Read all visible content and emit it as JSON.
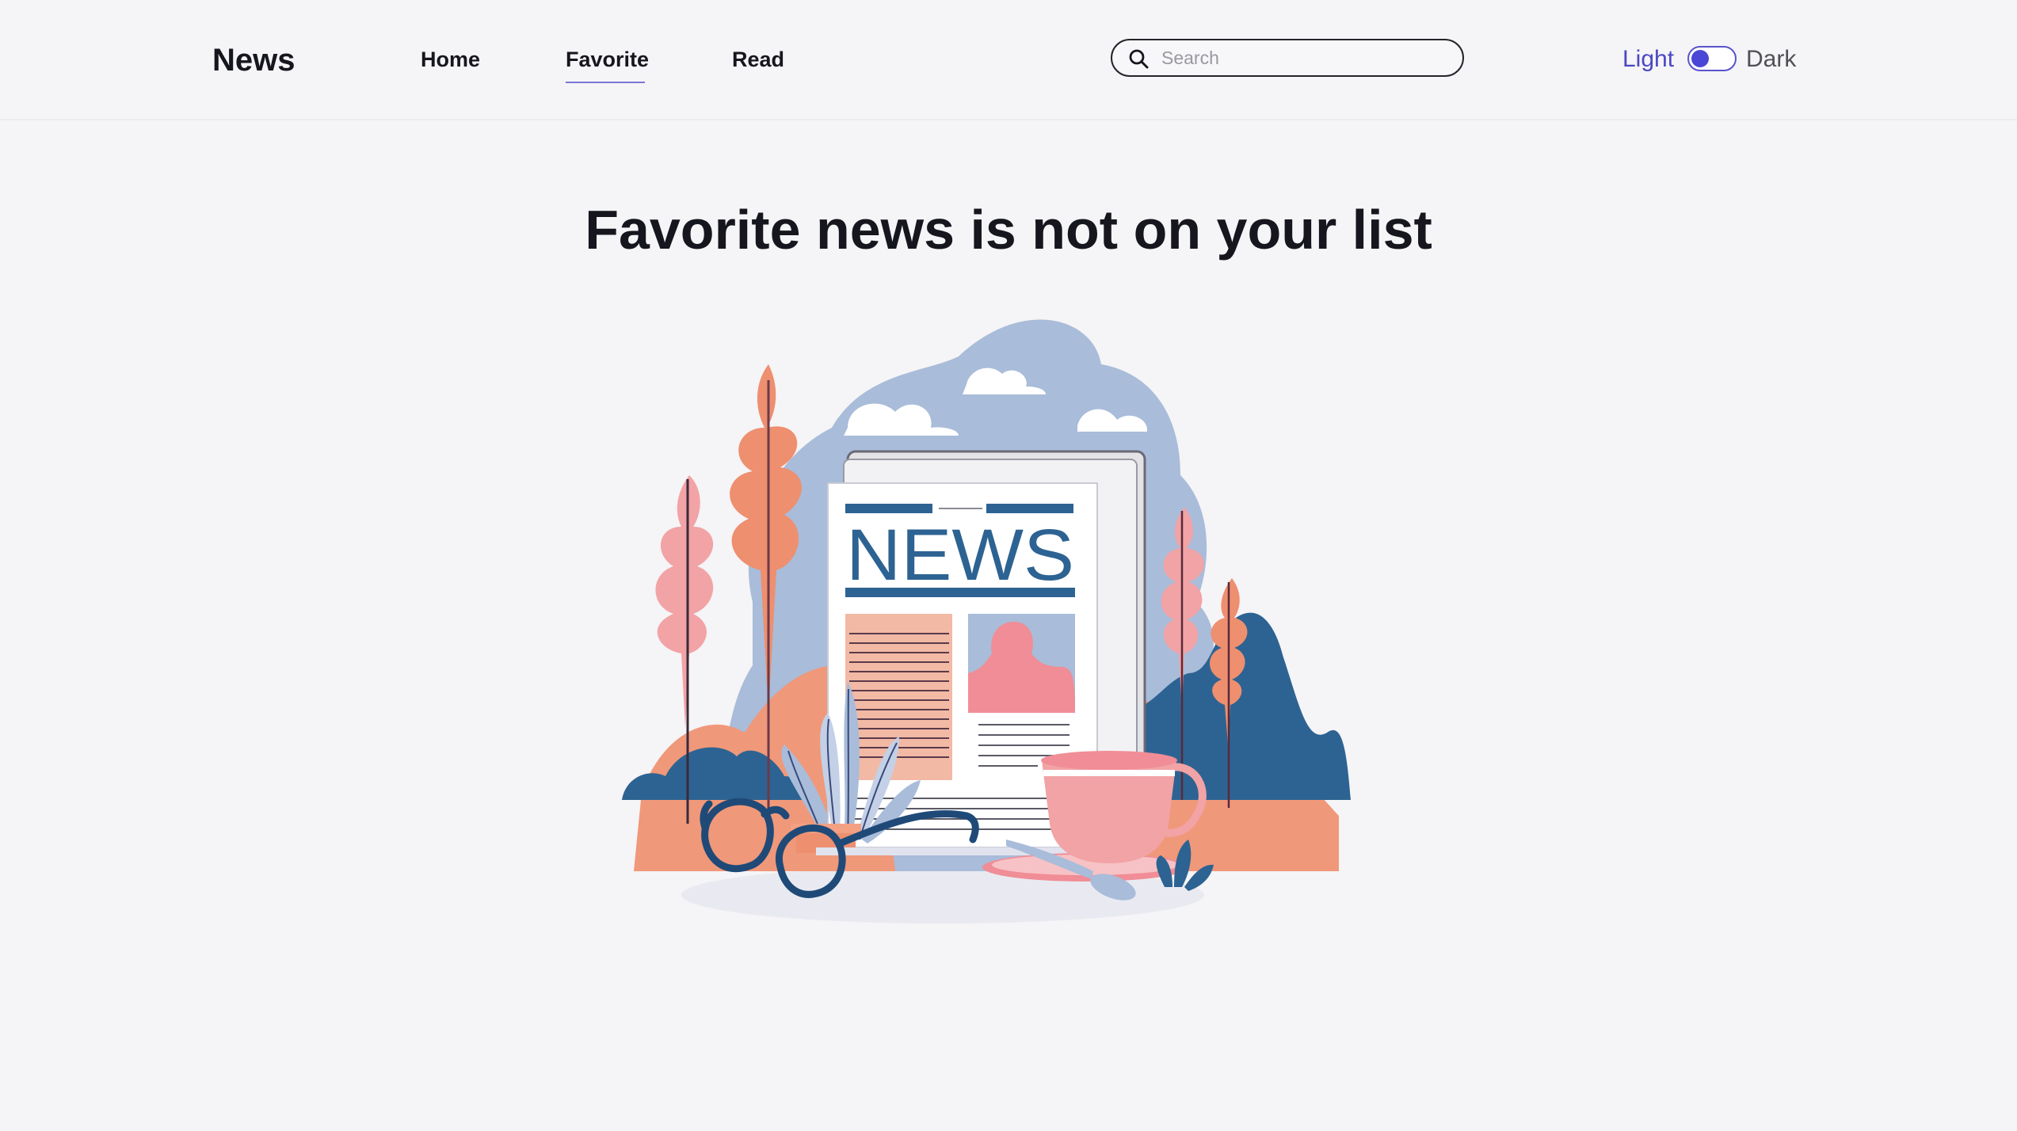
{
  "header": {
    "logo": "News",
    "nav": [
      {
        "label": "Home",
        "active": false
      },
      {
        "label": "Favorite",
        "active": true
      },
      {
        "label": "Read",
        "active": false
      }
    ],
    "search": {
      "placeholder": "Search",
      "value": "",
      "icon": "search-icon"
    },
    "theme": {
      "light_label": "Light",
      "dark_label": "Dark",
      "selected": "Light"
    }
  },
  "main": {
    "title": "Favorite news is not on your list",
    "illustration": {
      "icon": "empty-news-illustration",
      "headline_text": "NEWS"
    }
  },
  "colors": {
    "accent": "#4a47c4",
    "active_underline": "#7a77d6",
    "background": "#f5f4f6",
    "text": "#16161e",
    "illustration_blue": "#2d6392",
    "illustration_sky": "#a9bcd9",
    "illustration_orange": "#f0987a",
    "illustration_pink": "#f2a3a6"
  }
}
